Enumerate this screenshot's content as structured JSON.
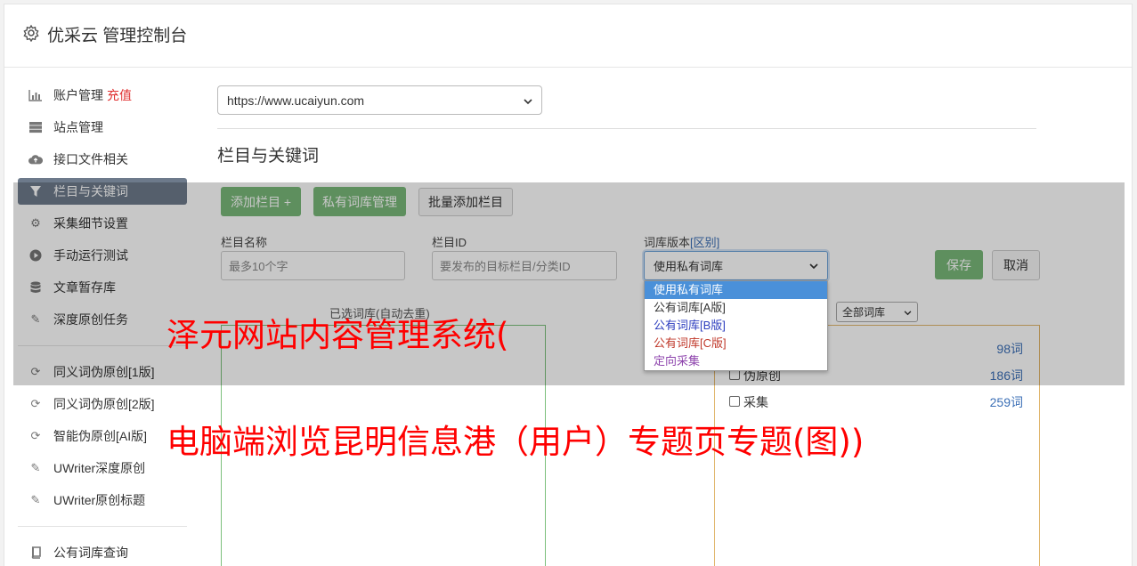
{
  "app": {
    "title": "优采云 管理控制台"
  },
  "sidebar": {
    "items": [
      {
        "icon": "bar-chart-icon",
        "label": "账户管理",
        "extra": "充值"
      },
      {
        "icon": "server-icon",
        "label": "站点管理"
      },
      {
        "icon": "cloud-upload-icon",
        "label": "接口文件相关"
      },
      {
        "icon": "filter-icon",
        "label": "栏目与关键词",
        "active": true
      },
      {
        "icon": "gears-icon",
        "label": "采集细节设置"
      },
      {
        "icon": "play-circle-icon",
        "label": "手动运行测试"
      },
      {
        "icon": "database-icon",
        "label": "文章暂存库"
      },
      {
        "icon": "edit-icon",
        "label": "深度原创任务"
      },
      {
        "icon": "refresh-icon",
        "label": "同义词伪原创[1版]"
      },
      {
        "icon": "refresh-icon",
        "label": "同义词伪原创[2版]"
      },
      {
        "icon": "refresh-icon",
        "label": "智能伪原创[AI版]"
      },
      {
        "icon": "edit-icon",
        "label": "UWriter深度原创"
      },
      {
        "icon": "edit-icon",
        "label": "UWriter原创标题"
      },
      {
        "icon": "book-icon",
        "label": "公有词库查询"
      }
    ]
  },
  "main": {
    "site_select_value": "https://www.ucaiyun.com",
    "section_title": "栏目与关键词",
    "buttons": {
      "add_column": "添加栏目 +",
      "private_lib": "私有词库管理",
      "batch_add": "批量添加栏目",
      "save": "保存",
      "cancel": "取消"
    },
    "form": {
      "name_label": "栏目名称",
      "name_placeholder": "最多10个字",
      "id_label": "栏目ID",
      "id_placeholder": "要发布的目标栏目/分类ID",
      "version_label": "词库版本",
      "version_link": "[区别]",
      "version_value": "使用私有词库"
    },
    "version_options": [
      {
        "label": "使用私有词库",
        "color": "#ffffff",
        "selected": true
      },
      {
        "label": "公有词库[A版]",
        "color": "#333333"
      },
      {
        "label": "公有词库[B版]",
        "color": "#2e3fbf"
      },
      {
        "label": "公有词库[C版]",
        "color": "#c0392b"
      },
      {
        "label": "定向采集",
        "color": "#8e44ad"
      }
    ],
    "selected_lib_label": "已选词库(自动去重)",
    "lib_filter_value": "全部词库",
    "libraries": [
      {
        "name": "",
        "count": "98词"
      },
      {
        "name": "伪原创",
        "count": "186词"
      },
      {
        "name": "采集",
        "count": "259词"
      }
    ]
  },
  "watermark": {
    "line1": "泽元网站内容管理系统(",
    "line2": "电脑端浏览昆明信息港（用户）专题页专题(图))"
  }
}
